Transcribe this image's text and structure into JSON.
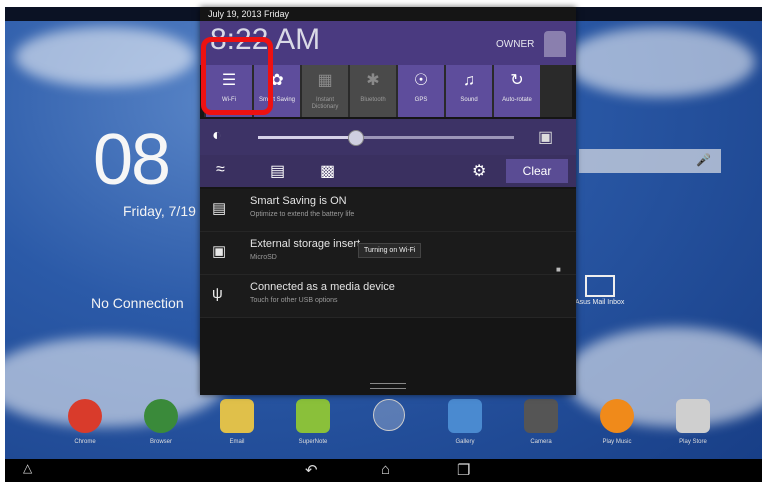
{
  "status_bar": {
    "date": "July 19, 2013 Friday"
  },
  "home": {
    "clock": "08",
    "date": "Friday, 7/19",
    "no_connection": "No Connection",
    "mail_label": "Asus Mail Inbox"
  },
  "panel": {
    "time": "8:22 AM",
    "owner": "OWNER",
    "tiles": [
      {
        "label": "Wi-Fi",
        "icon": "wifi-icon",
        "state": "on"
      },
      {
        "label": "Smart Saving",
        "icon": "smart-saving-icon",
        "state": "on"
      },
      {
        "label": "Instant Dictionary",
        "icon": "instant-dictionary-icon",
        "state": "off"
      },
      {
        "label": "Bluetooth",
        "icon": "bluetooth-icon",
        "state": "off"
      },
      {
        "label": "GPS",
        "icon": "gps-icon",
        "state": "on"
      },
      {
        "label": "Sound",
        "icon": "sound-icon",
        "state": "on"
      },
      {
        "label": "Auto-rotate",
        "icon": "auto-rotate-icon",
        "state": "on"
      }
    ],
    "brightness_level": 0.38,
    "clear_label": "Clear",
    "notifications": [
      {
        "title": "Smart Saving is ON",
        "subtitle": "Optimize to extend the battery life"
      },
      {
        "title": "External storage insert",
        "subtitle": "MicroSD"
      },
      {
        "title": "Connected as a media device",
        "subtitle": "Touch for other USB options"
      }
    ],
    "toast": "Turning on Wi-Fi"
  },
  "dock": [
    {
      "label": "Chrome",
      "color": "#d93b2b"
    },
    {
      "label": "Browser",
      "color": "#3a8a3a"
    },
    {
      "label": "Email",
      "color": "#e0c04a"
    },
    {
      "label": "SuperNote",
      "color": "#8ac03a"
    },
    {
      "label": "",
      "color": "#888888"
    },
    {
      "label": "Gallery",
      "color": "#4a8ad0"
    },
    {
      "label": "Camera",
      "color": "#555555"
    },
    {
      "label": "Play Music",
      "color": "#f08a1a"
    },
    {
      "label": "Play Store",
      "color": "#cfcfcf"
    }
  ],
  "colors": {
    "accent": "#5e4d9c",
    "highlight": "#ee1111"
  }
}
